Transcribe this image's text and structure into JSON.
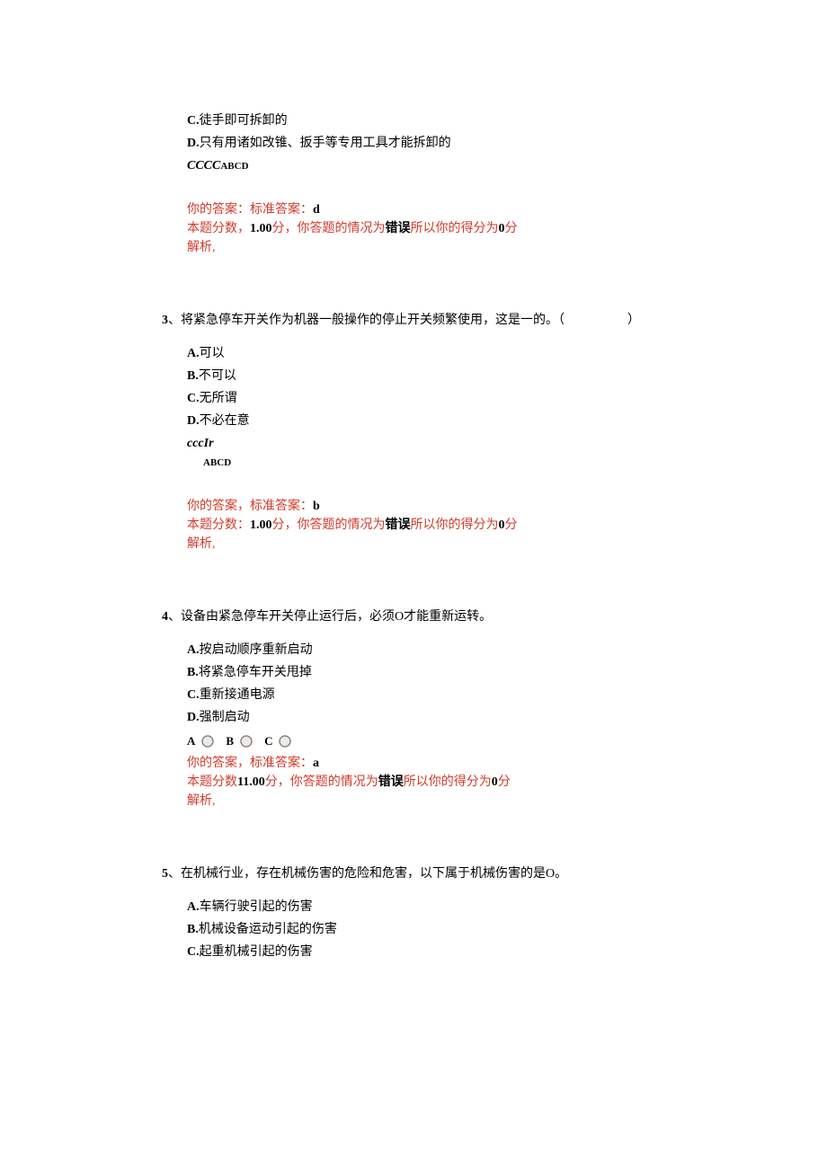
{
  "q2_tail": {
    "options": {
      "c": {
        "letter": "C.",
        "text": "徒手即可拆卸的"
      },
      "d": {
        "letter": "D.",
        "text": "只有用诸如改锥、扳手等专用工具才能拆卸的"
      }
    },
    "label_left": "CCCC",
    "label_right": "ABCD",
    "your_answer_label": "你的答案：",
    "std_answer_label": "标准答案：",
    "std_answer": "d",
    "score_prefix": "本题分数，",
    "score_val": "1.00",
    "score_unit": "分",
    "status_prefix": "，你答题的情况为",
    "status_wrong": "错误",
    "status_suffix": "所以你的得分为",
    "got_score": "0",
    "got_unit": "分",
    "analysis": "解析,"
  },
  "q3": {
    "num": "3",
    "sep": "、",
    "stem": "将紧急停车开关作为机器一般操作的停止开关频繁使用，这是一的。（",
    "stem_end": "）",
    "options": {
      "a": {
        "letter": "A.",
        "text": "可以"
      },
      "b": {
        "letter": "B.",
        "text": "不可以"
      },
      "c": {
        "letter": "C.",
        "text": "无所谓"
      },
      "d": {
        "letter": "D.",
        "text": "不必在意"
      }
    },
    "label_left": "cccIr",
    "label_right": "ABCD",
    "your_answer_label": "你的答案，",
    "std_answer_label": "标准答案：",
    "std_answer": "b",
    "score_prefix": "本题分数：",
    "score_val": "1.00",
    "score_unit": "分",
    "status_prefix": "，你答题的情况为",
    "status_wrong": "错误",
    "status_suffix": "所以你的得分为",
    "got_score": "0",
    "got_unit": "分",
    "analysis": "解析,"
  },
  "q4": {
    "num": "4",
    "sep": "、",
    "stem": "设备由紧急停车开关停止运行后，必须O才能重新运转。",
    "options": {
      "a": {
        "letter": "A.",
        "text": "按启动顺序重新启动"
      },
      "b": {
        "letter": "B.",
        "text": "将紧急停车开关甩掉"
      },
      "c": {
        "letter": "C.",
        "text": "重新接通电源"
      },
      "d": {
        "letter": "D.",
        "text": "强制启动"
      }
    },
    "radio_labels": {
      "a": "A",
      "b": "B",
      "c": "C"
    },
    "your_answer_label": "你的答案，",
    "std_answer_label": "标准答案：",
    "std_answer": "a",
    "score_prefix": "本题分数",
    "score_val": "11.00",
    "score_unit": "分",
    "status_prefix": "，你答题的情况为",
    "status_wrong": "错误",
    "status_suffix": "所以你的得分为",
    "got_score": "0",
    "got_unit": "分",
    "analysis": "解析,"
  },
  "q5": {
    "num": "5",
    "sep": "、",
    "stem": "在机械行业，存在机械伤害的危险和危害，以下属于机械伤害的是O。",
    "options": {
      "a": {
        "letter": "A.",
        "text": "车辆行驶引起的伤害"
      },
      "b": {
        "letter": "B.",
        "text": "机械设备运动引起的伤害"
      },
      "c": {
        "letter": "C.",
        "text": "起重机械引起的伤害"
      }
    }
  }
}
